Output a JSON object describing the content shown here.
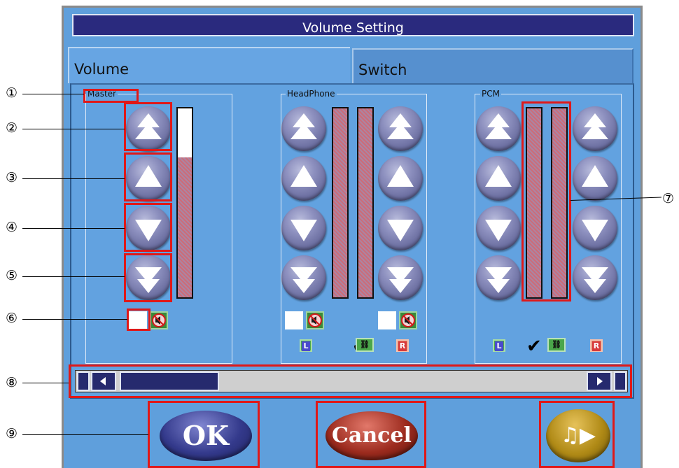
{
  "window": {
    "title": "Volume Setting"
  },
  "tabs": [
    {
      "label": "Volume",
      "active": true
    },
    {
      "label": "Switch",
      "active": false
    }
  ],
  "groups": {
    "master": {
      "label": "Master",
      "level": 0.74
    },
    "headphone": {
      "label": "HeadPhone",
      "levels": [
        1.0,
        1.0
      ]
    },
    "pcm": {
      "label": "PCM",
      "levels": [
        1.0,
        1.0
      ]
    }
  },
  "channel_badges": {
    "left": "L",
    "right": "R",
    "link": "⛓",
    "check": "✔"
  },
  "icons": {
    "fast_up": "double-up-arrow-icon",
    "up": "up-arrow-icon",
    "down": "down-arrow-icon",
    "fast_down": "double-down-arrow-icon",
    "mute": "speaker-mute-icon",
    "music_play": "music-play-icon"
  },
  "buttons": {
    "ok": "OK",
    "cancel": "Cancel",
    "music": "♫▶"
  },
  "scrollbar": {
    "position": 0.0
  },
  "callouts": [
    "①",
    "②",
    "③",
    "④",
    "⑤",
    "⑥",
    "⑦",
    "⑧",
    "⑨"
  ],
  "colors": {
    "background": "#5f9fdc",
    "title_bar": "#2a2a7e",
    "ok_button": "#343a8c",
    "cancel_button": "#9c2b1e",
    "music_button": "#b08a16",
    "annotation": "#e01818"
  }
}
